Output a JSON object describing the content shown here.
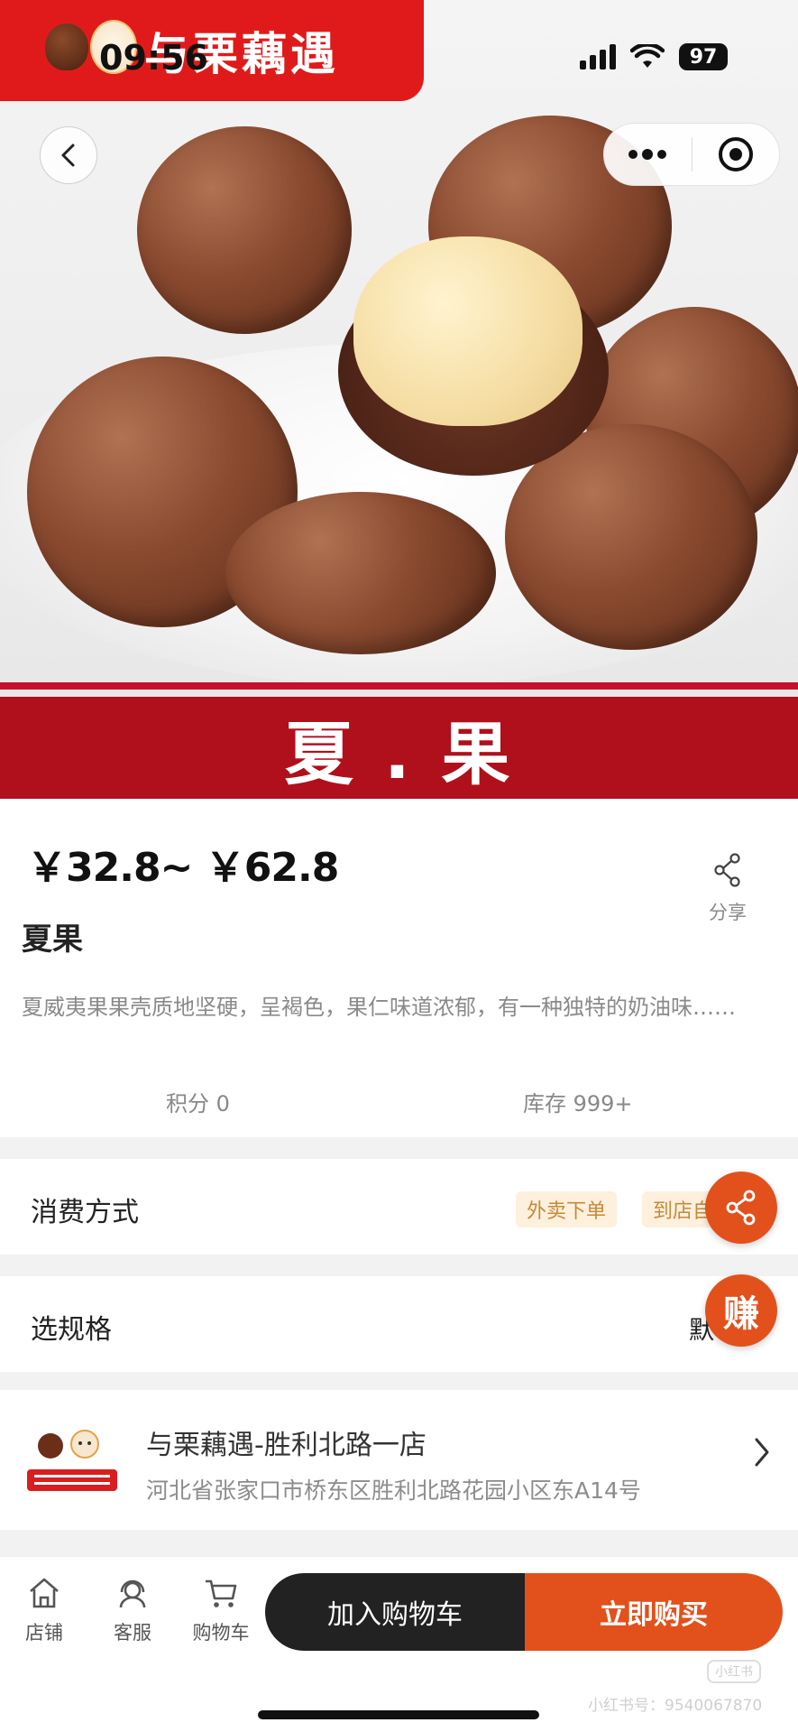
{
  "status_bar": {
    "time": "09:56",
    "battery": "97"
  },
  "brand": {
    "name": "与栗藕遇"
  },
  "hero": {
    "banner_text": "夏 . 果"
  },
  "product": {
    "price": "￥32.8~ ￥62.8",
    "share_label": "分享",
    "title": "夏果",
    "description": "夏威夷果果壳质地坚硬，呈褐色，果仁味道浓郁，有一种独特的奶油味……",
    "points": "积分 0",
    "stock": "库存 999+"
  },
  "consumption": {
    "label": "消费方式",
    "options": [
      "外卖下单",
      "到店自"
    ]
  },
  "spec": {
    "label": "选规格",
    "value": "默"
  },
  "store": {
    "name": "与栗藕遇-胜利北路一店",
    "address": "河北省张家口市桥东区胜利北路花园小区东A14号"
  },
  "floating": {
    "earn_label": "赚"
  },
  "bottom_bar": {
    "tabs": [
      {
        "label": "店铺",
        "icon": "store-icon"
      },
      {
        "label": "客服",
        "icon": "customer-service-icon"
      },
      {
        "label": "购物车",
        "icon": "cart-icon"
      }
    ],
    "add_to_cart": "加入购物车",
    "buy_now": "立即购买"
  },
  "watermark": {
    "badge": "小红书",
    "text": "小红书号：9540067870"
  },
  "colors": {
    "brand_red": "#e01a1a",
    "accent_orange": "#e2511c",
    "dark_button": "#222222",
    "tag_bg": "#fdf0dc"
  }
}
